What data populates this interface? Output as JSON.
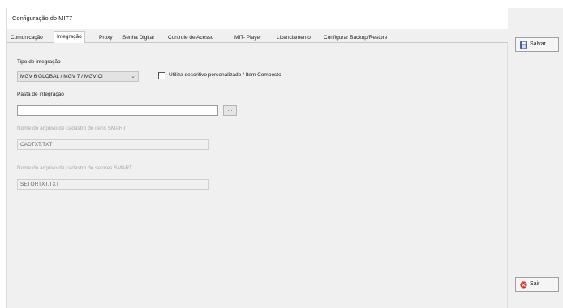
{
  "window": {
    "title": "Configuração do MIT7"
  },
  "tabs": [
    {
      "label": "Comunicação",
      "active": false
    },
    {
      "label": "Integração",
      "active": true
    },
    {
      "label": "Proxy",
      "active": false
    },
    {
      "label": "Senha Digital",
      "active": false
    },
    {
      "label": "Controle de Acesso",
      "active": false
    },
    {
      "label": "MIT- Player",
      "active": false
    },
    {
      "label": "Licenciamento",
      "active": false
    },
    {
      "label": "Configurar Backup/Restore",
      "active": false
    }
  ],
  "integracao": {
    "tipo_label": "Tipo de integração",
    "tipo_value": "MGV 6 GLOBAL / MGV 7 / MGV Cl",
    "checkbox_label": "Utiliza descritivo personalizado / Item Composto",
    "checkbox_checked": false,
    "pasta_label": "Pasta de integração",
    "pasta_value": "",
    "browse_label": "...",
    "itens_label": "Nome do arquivo de cadastro de itens SMART",
    "itens_value": "CADTXT.TXT",
    "setores_label": "Nome do arquivo de cadastro de setores SMART",
    "setores_value": "SETORTXT.TXT"
  },
  "actions": {
    "save_label": "Salvar",
    "exit_label": "Sair"
  },
  "colors": {
    "save_icon": "#3a5fa8",
    "exit_icon": "#d9342b"
  }
}
